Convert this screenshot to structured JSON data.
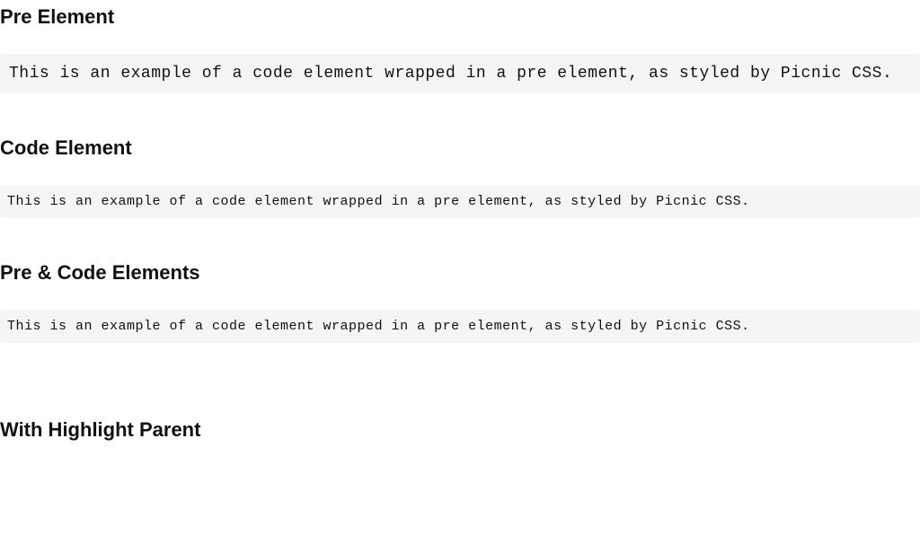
{
  "sections": {
    "pre_element": {
      "heading": "Pre Element",
      "code": "This is an example of a code element wrapped in a pre element, as styled by Picnic CSS."
    },
    "code_element": {
      "heading": "Code Element",
      "code": "This is an example of a code element wrapped in a pre element, as styled by Picnic CSS."
    },
    "pre_and_code": {
      "heading": "Pre & Code Elements",
      "code": "This is an example of a code element wrapped in a pre element, as styled by Picnic CSS."
    },
    "highlight_parent": {
      "heading": "With Highlight Parent"
    }
  }
}
